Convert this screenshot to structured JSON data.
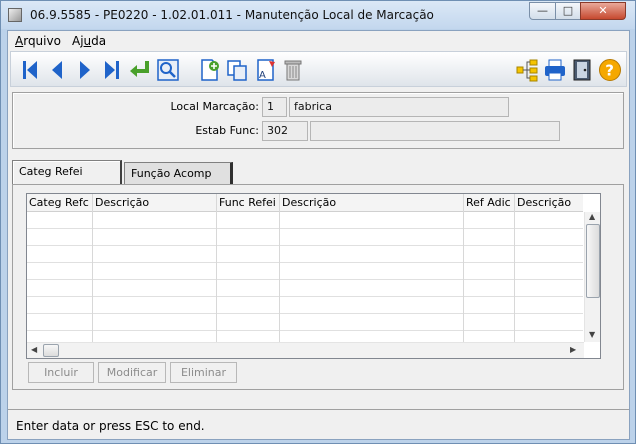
{
  "window": {
    "title": "06.9.5585 - PE0220 - 1.02.01.011 - Manutenção Local de Marcação",
    "min_glyph": "—",
    "max_glyph": "□",
    "close_glyph": "✕"
  },
  "menu": {
    "arquivo": {
      "accel": "A",
      "rest": "rquivo"
    },
    "ajuda": {
      "pre": "Aj",
      "accel": "u",
      "rest": "da"
    }
  },
  "toolbar": {
    "icons": [
      "first-record-icon",
      "previous-record-icon",
      "next-record-icon",
      "last-record-icon",
      "goto-icon",
      "search-icon",
      "new-record-icon",
      "copy-record-icon",
      "edit-record-icon",
      "delete-record-icon",
      "tree-structure-icon",
      "print-icon",
      "exit-icon",
      "help-icon"
    ]
  },
  "form": {
    "local_marcacao_label": "Local Marcação:",
    "local_marcacao_code": "1",
    "local_marcacao_desc": "fabrica",
    "estab_func_label": "Estab Func:",
    "estab_func_code": "302",
    "estab_func_desc": ""
  },
  "tabs": [
    {
      "label": "Categ Refei",
      "active": true
    },
    {
      "label": "Função Acomp",
      "active": false
    }
  ],
  "grid": {
    "columns": [
      "Categ Refc",
      "Descrição",
      "Func Refei",
      "Descrição",
      "Ref Adic",
      "Descrição"
    ],
    "rows": []
  },
  "buttons": {
    "incluir": "Incluir",
    "modificar": "Modificar",
    "eliminar": "Eliminar"
  },
  "status": {
    "message": "Enter data or press ESC to end."
  },
  "colors": {
    "accent": "#3a6fc4",
    "toolbar_arrow": "#1f63c9",
    "toolbar_green": "#49a02b",
    "help": "#f5a800"
  }
}
